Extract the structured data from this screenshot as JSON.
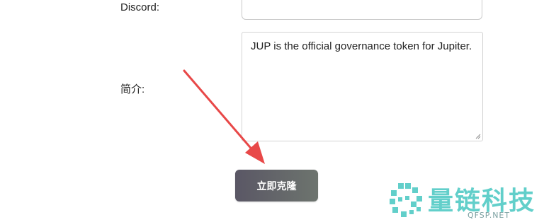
{
  "form": {
    "discord_label": "Discord:",
    "discord_value": "",
    "intro_label": "简介:",
    "intro_value": "JUP is the official governance token for Jupiter.",
    "submit_label": "立即克隆"
  },
  "watermark": {
    "name": "量链科技",
    "site": "QFSP.NET"
  },
  "colors": {
    "button_gradient_start": "#5a5765",
    "button_gradient_end": "#6d746e",
    "arrow": "#e84848",
    "watermark": "#47c7c1"
  }
}
